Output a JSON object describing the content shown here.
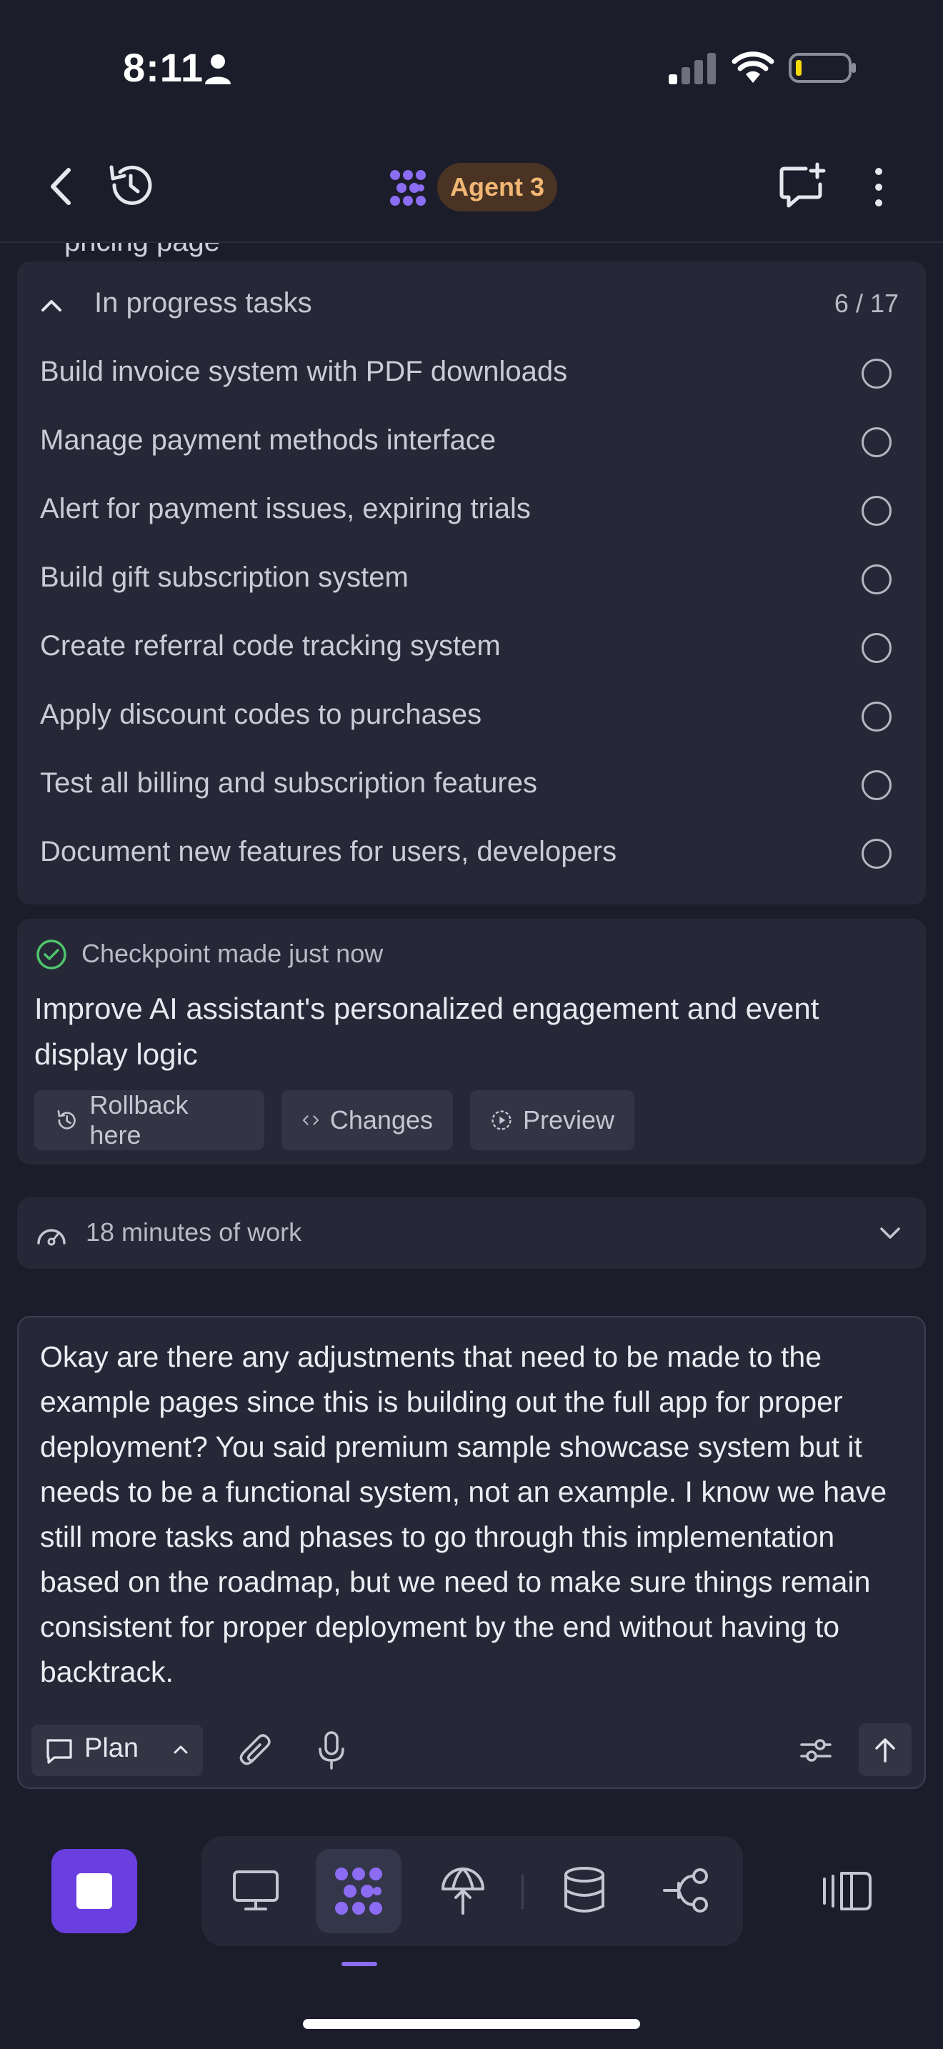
{
  "status_bar": {
    "time": "8:11"
  },
  "header": {
    "agent_name": "Agent 3"
  },
  "scrolled_text": "pricing page",
  "tasks": {
    "title": "In progress tasks",
    "count": "6 / 17",
    "items": [
      "Build invoice system with PDF downloads",
      "Manage payment methods interface",
      "Alert for payment issues, expiring trials",
      "Build gift subscription system",
      "Create referral code tracking system",
      "Apply discount codes to purchases",
      "Test all billing and subscription features",
      "Document new features for users, developers"
    ]
  },
  "checkpoint": {
    "label": "Checkpoint made just now",
    "description": "Improve AI assistant's personalized engagement and event display logic",
    "buttons": {
      "rollback": "Rollback here",
      "changes": "Changes",
      "preview": "Preview"
    }
  },
  "work": {
    "label": "18 minutes of work"
  },
  "input": {
    "value": "Okay are there any adjustments that need to be made to the example pages since this is building out the full app for proper deployment? You said premium sample showcase system but it needs to be a functional system, not an example. I know we have still more tasks and phases to go through this implementation based on the roadmap, but we need to make sure things remain consistent for proper deployment by the end without having to backtrack.",
    "mode": "Plan"
  },
  "colors": {
    "accent": "#6a3fe0",
    "badge_text": "#f2b774",
    "check": "#4fc46b",
    "background": "#1c1d2b"
  },
  "nav": {
    "icons": [
      "desktop-icon",
      "agent-icon",
      "deploy-icon",
      "database-icon",
      "git-icon"
    ],
    "active": "agent-icon"
  }
}
